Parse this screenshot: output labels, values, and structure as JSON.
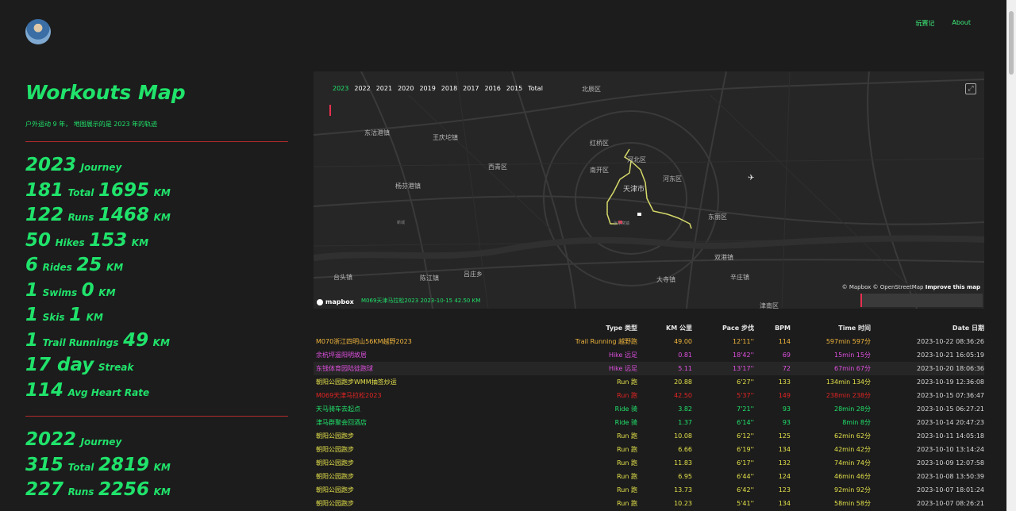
{
  "nav": {
    "links": [
      "玩赛记",
      "About"
    ]
  },
  "sidebar": {
    "title": "Workouts Map",
    "subtitle": "户外运动 9 年， 地图展示的是 2023 年的轨迹",
    "y2023": {
      "journey_year": "2023",
      "journey_label": "Journey",
      "total_count": "181",
      "total_label": "Total",
      "total_km": "1695",
      "km_unit": "KM",
      "runs_count": "122",
      "runs_label": "Runs",
      "runs_km": "1468",
      "hikes_count": "50",
      "hikes_label": "Hikes",
      "hikes_km": "153",
      "rides_count": "6",
      "rides_label": "Rides",
      "rides_km": "25",
      "swims_count": "1",
      "swims_label": "Swims",
      "swims_km": "0",
      "skis_count": "1",
      "skis_label": "Skis",
      "skis_km": "1",
      "trail_count": "1",
      "trail_label": "Trail Runnings",
      "trail_km": "49",
      "streak_value": "17 day",
      "streak_label": "Streak",
      "hr_value": "114",
      "hr_label": "Avg Heart Rate"
    },
    "y2022": {
      "journey_year": "2022",
      "journey_label": "Journey",
      "total_count": "315",
      "total_label": "Total",
      "total_km": "2819",
      "km_unit": "KM",
      "runs_count": "227",
      "runs_label": "Runs",
      "runs_km": "2256"
    }
  },
  "map": {
    "years": [
      "2023",
      "2022",
      "2021",
      "2020",
      "2019",
      "2018",
      "2017",
      "2016",
      "2015",
      "Total"
    ],
    "active_year": "2023",
    "labels": {
      "beichen": "北辰区",
      "dongdian": "东沽港镇",
      "wangqing": "王庆坨镇",
      "hongqiao": "红桥区",
      "hebei": "河北区",
      "xiqing": "西青区",
      "nankai": "南开区",
      "hedong": "河东区",
      "tianjin": "天津市",
      "yangfen": "杨芬港镇",
      "dongli": "东丽区",
      "taitou": "台头镇",
      "chenhang": "陈江镇",
      "xinsanzhuang": "吕庄乡",
      "dasi": "大寺镇",
      "shuanggang": "双港镇",
      "jinnan": "津南区",
      "xinxing": "辛庄镇",
      "zhangjiawo": "张家窝镇",
      "shenbu": "新城"
    },
    "logo": "mapbox",
    "run_info": "M069天津马拉松2023 2023-10-15 42.50 KM",
    "attribution_mapbox": "© Mapbox",
    "attribution_osm": "© OpenStreetMap",
    "attribution_improve": "Improve this map",
    "colors": {
      "route": "#d6d96a",
      "active_year": "#20e36b",
      "start_flag": "#e8304f"
    }
  },
  "table": {
    "headers": {
      "type": "Type 类型",
      "km": "KM 公里",
      "pace": "Pace 步伐",
      "bpm": "BPM",
      "time": "Time 时间",
      "date": "Date 日期"
    },
    "rows": [
      {
        "name": "M070浙江四明山56KM越野2023",
        "type": "Trail Running 越野跑",
        "km": "49.00",
        "pace": "12'11''",
        "bpm": "114",
        "time": "597min 597分",
        "date": "2023-10-22 08:36:26",
        "color": "#f0b53c"
      },
      {
        "name": "余杭坪遥阳明故居",
        "type": "Hike 远足",
        "km": "0.81",
        "pace": "18'42''",
        "bpm": "69",
        "time": "15min 15分",
        "date": "2023-10-21 16:05:19",
        "color": "#e050e0"
      },
      {
        "name": "东钱体育园陆徒跑球",
        "type": "Hike 远足",
        "km": "5.11",
        "pace": "13'17''",
        "bpm": "72",
        "time": "67min 67分",
        "date": "2023-10-20 18:06:36",
        "color": "#e050e0"
      },
      {
        "name": "朝阳公园跑步WMM抽签炒运",
        "type": "Run 跑",
        "km": "20.88",
        "pace": "6'27''",
        "bpm": "133",
        "time": "134min 134分",
        "date": "2023-10-19 12:36:08",
        "color": "#e3e04a"
      },
      {
        "name": "M069天津马拉松2023",
        "type": "Run 跑",
        "km": "42.50",
        "pace": "5'37''",
        "bpm": "149",
        "time": "238min 238分",
        "date": "2023-10-15 07:36:47",
        "color": "#e42424"
      },
      {
        "name": "天马骑车去起点",
        "type": "Ride 骑",
        "km": "3.82",
        "pace": "7'21''",
        "bpm": "93",
        "time": "28min 28分",
        "date": "2023-10-15 06:27:21",
        "color": "#20e36b"
      },
      {
        "name": "津马群聚会回酒店",
        "type": "Ride 骑",
        "km": "1.37",
        "pace": "6'14''",
        "bpm": "93",
        "time": "8min 8分",
        "date": "2023-10-14 20:47:23",
        "color": "#20e36b"
      },
      {
        "name": "朝阳公园跑步",
        "type": "Run 跑",
        "km": "10.08",
        "pace": "6'12''",
        "bpm": "125",
        "time": "62min 62分",
        "date": "2023-10-11 14:05:18",
        "color": "#e3e04a"
      },
      {
        "name": "朝阳公园跑步",
        "type": "Run 跑",
        "km": "6.66",
        "pace": "6'19''",
        "bpm": "134",
        "time": "42min 42分",
        "date": "2023-10-10 13:14:24",
        "color": "#e3e04a"
      },
      {
        "name": "朝阳公园跑步",
        "type": "Run 跑",
        "km": "11.83",
        "pace": "6'17''",
        "bpm": "132",
        "time": "74min 74分",
        "date": "2023-10-09 12:07:58",
        "color": "#e3e04a"
      },
      {
        "name": "朝阳公园跑步",
        "type": "Run 跑",
        "km": "6.95",
        "pace": "6'44''",
        "bpm": "124",
        "time": "46min 46分",
        "date": "2023-10-08 13:50:39",
        "color": "#e3e04a"
      },
      {
        "name": "朝阳公园跑步",
        "type": "Run 跑",
        "km": "13.73",
        "pace": "6'42''",
        "bpm": "123",
        "time": "92min 92分",
        "date": "2023-10-07 18:01:24",
        "color": "#e3e04a"
      },
      {
        "name": "朝阳公园跑步",
        "type": "Run 跑",
        "km": "10.23",
        "pace": "5'41''",
        "bpm": "134",
        "time": "58min 58分",
        "date": "2023-10-07 08:26:21",
        "color": "#e3e04a"
      }
    ]
  }
}
